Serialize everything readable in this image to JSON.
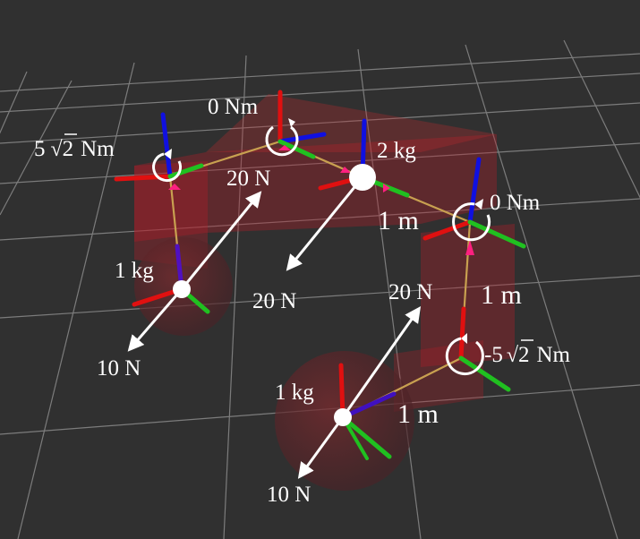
{
  "scene": {
    "colors": {
      "background": "#303030",
      "grid": "#8a8a8a",
      "link": "#c8a050",
      "x_axis": "#e01010",
      "y_axis": "#20c020",
      "z_axis": "#1010e0",
      "force_arrow": "#ffffff",
      "joint_marker": "#ff2080",
      "body_tint": "#b41e28"
    },
    "labels": {
      "torque_top_left": "5",
      "torque_top_left_root": "2",
      "torque_top_left_unit": "Nm",
      "torque_top": "0 Nm",
      "torque_right": "0 Nm",
      "torque_right_bottom": "-5",
      "torque_right_bottom_root": "2",
      "torque_right_bottom_unit": "Nm",
      "mass_center": "2 kg",
      "mass_left": "1 kg",
      "mass_bottom": "1 kg",
      "force_top_left": "20 N",
      "force_center": "20 N",
      "force_mid_right": "20 N",
      "force_left_down": "10 N",
      "force_bottom_down": "10 N",
      "length_top_right": "1 m",
      "length_right": "1 m",
      "length_bottom": "1 m"
    }
  }
}
